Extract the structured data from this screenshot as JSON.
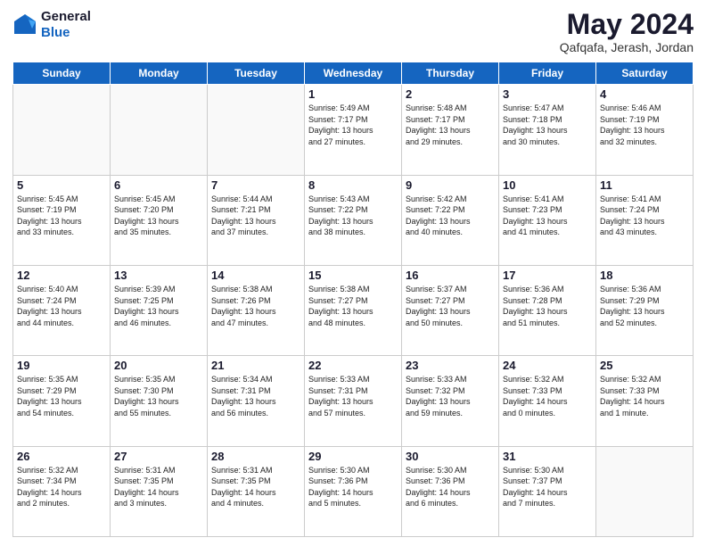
{
  "header": {
    "logo_line1": "General",
    "logo_line2": "Blue",
    "month": "May 2024",
    "location": "Qafqafa, Jerash, Jordan"
  },
  "weekdays": [
    "Sunday",
    "Monday",
    "Tuesday",
    "Wednesday",
    "Thursday",
    "Friday",
    "Saturday"
  ],
  "weeks": [
    [
      {
        "day": "",
        "info": ""
      },
      {
        "day": "",
        "info": ""
      },
      {
        "day": "",
        "info": ""
      },
      {
        "day": "1",
        "info": "Sunrise: 5:49 AM\nSunset: 7:17 PM\nDaylight: 13 hours\nand 27 minutes."
      },
      {
        "day": "2",
        "info": "Sunrise: 5:48 AM\nSunset: 7:17 PM\nDaylight: 13 hours\nand 29 minutes."
      },
      {
        "day": "3",
        "info": "Sunrise: 5:47 AM\nSunset: 7:18 PM\nDaylight: 13 hours\nand 30 minutes."
      },
      {
        "day": "4",
        "info": "Sunrise: 5:46 AM\nSunset: 7:19 PM\nDaylight: 13 hours\nand 32 minutes."
      }
    ],
    [
      {
        "day": "5",
        "info": "Sunrise: 5:45 AM\nSunset: 7:19 PM\nDaylight: 13 hours\nand 33 minutes."
      },
      {
        "day": "6",
        "info": "Sunrise: 5:45 AM\nSunset: 7:20 PM\nDaylight: 13 hours\nand 35 minutes."
      },
      {
        "day": "7",
        "info": "Sunrise: 5:44 AM\nSunset: 7:21 PM\nDaylight: 13 hours\nand 37 minutes."
      },
      {
        "day": "8",
        "info": "Sunrise: 5:43 AM\nSunset: 7:22 PM\nDaylight: 13 hours\nand 38 minutes."
      },
      {
        "day": "9",
        "info": "Sunrise: 5:42 AM\nSunset: 7:22 PM\nDaylight: 13 hours\nand 40 minutes."
      },
      {
        "day": "10",
        "info": "Sunrise: 5:41 AM\nSunset: 7:23 PM\nDaylight: 13 hours\nand 41 minutes."
      },
      {
        "day": "11",
        "info": "Sunrise: 5:41 AM\nSunset: 7:24 PM\nDaylight: 13 hours\nand 43 minutes."
      }
    ],
    [
      {
        "day": "12",
        "info": "Sunrise: 5:40 AM\nSunset: 7:24 PM\nDaylight: 13 hours\nand 44 minutes."
      },
      {
        "day": "13",
        "info": "Sunrise: 5:39 AM\nSunset: 7:25 PM\nDaylight: 13 hours\nand 46 minutes."
      },
      {
        "day": "14",
        "info": "Sunrise: 5:38 AM\nSunset: 7:26 PM\nDaylight: 13 hours\nand 47 minutes."
      },
      {
        "day": "15",
        "info": "Sunrise: 5:38 AM\nSunset: 7:27 PM\nDaylight: 13 hours\nand 48 minutes."
      },
      {
        "day": "16",
        "info": "Sunrise: 5:37 AM\nSunset: 7:27 PM\nDaylight: 13 hours\nand 50 minutes."
      },
      {
        "day": "17",
        "info": "Sunrise: 5:36 AM\nSunset: 7:28 PM\nDaylight: 13 hours\nand 51 minutes."
      },
      {
        "day": "18",
        "info": "Sunrise: 5:36 AM\nSunset: 7:29 PM\nDaylight: 13 hours\nand 52 minutes."
      }
    ],
    [
      {
        "day": "19",
        "info": "Sunrise: 5:35 AM\nSunset: 7:29 PM\nDaylight: 13 hours\nand 54 minutes."
      },
      {
        "day": "20",
        "info": "Sunrise: 5:35 AM\nSunset: 7:30 PM\nDaylight: 13 hours\nand 55 minutes."
      },
      {
        "day": "21",
        "info": "Sunrise: 5:34 AM\nSunset: 7:31 PM\nDaylight: 13 hours\nand 56 minutes."
      },
      {
        "day": "22",
        "info": "Sunrise: 5:33 AM\nSunset: 7:31 PM\nDaylight: 13 hours\nand 57 minutes."
      },
      {
        "day": "23",
        "info": "Sunrise: 5:33 AM\nSunset: 7:32 PM\nDaylight: 13 hours\nand 59 minutes."
      },
      {
        "day": "24",
        "info": "Sunrise: 5:32 AM\nSunset: 7:33 PM\nDaylight: 14 hours\nand 0 minutes."
      },
      {
        "day": "25",
        "info": "Sunrise: 5:32 AM\nSunset: 7:33 PM\nDaylight: 14 hours\nand 1 minute."
      }
    ],
    [
      {
        "day": "26",
        "info": "Sunrise: 5:32 AM\nSunset: 7:34 PM\nDaylight: 14 hours\nand 2 minutes."
      },
      {
        "day": "27",
        "info": "Sunrise: 5:31 AM\nSunset: 7:35 PM\nDaylight: 14 hours\nand 3 minutes."
      },
      {
        "day": "28",
        "info": "Sunrise: 5:31 AM\nSunset: 7:35 PM\nDaylight: 14 hours\nand 4 minutes."
      },
      {
        "day": "29",
        "info": "Sunrise: 5:30 AM\nSunset: 7:36 PM\nDaylight: 14 hours\nand 5 minutes."
      },
      {
        "day": "30",
        "info": "Sunrise: 5:30 AM\nSunset: 7:36 PM\nDaylight: 14 hours\nand 6 minutes."
      },
      {
        "day": "31",
        "info": "Sunrise: 5:30 AM\nSunset: 7:37 PM\nDaylight: 14 hours\nand 7 minutes."
      },
      {
        "day": "",
        "info": ""
      }
    ]
  ]
}
